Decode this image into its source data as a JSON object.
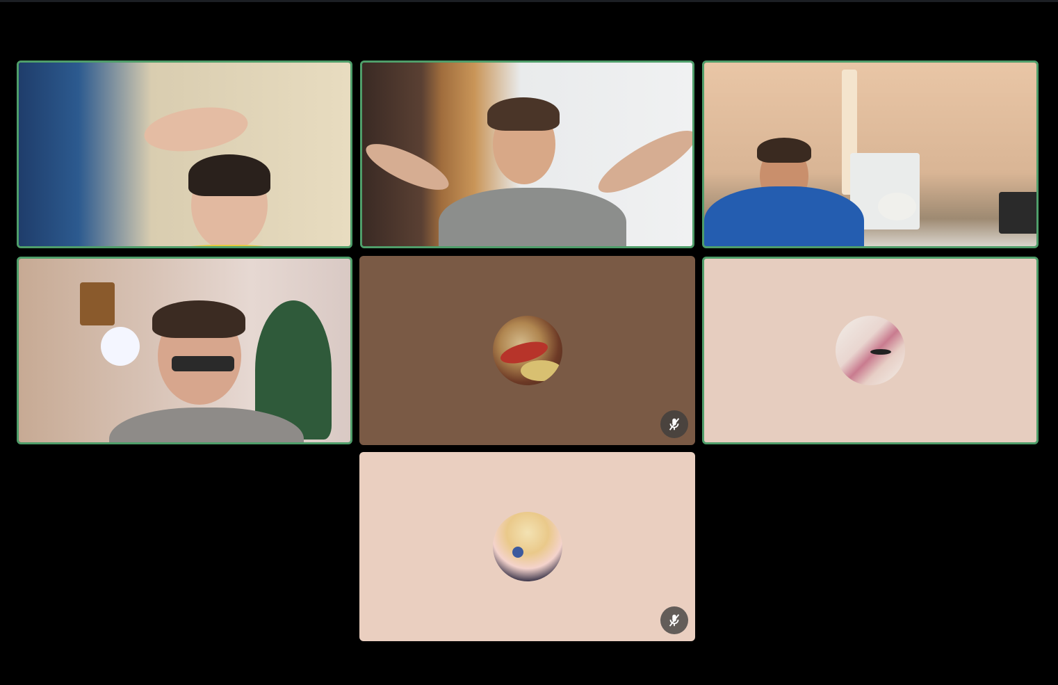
{
  "meeting": {
    "layout": "gallery",
    "accent_color": "#4f9e6a",
    "participants": [
      {
        "tile": "participant-1",
        "video": "on",
        "speaking": true,
        "background": "#8b7d6b"
      },
      {
        "tile": "participant-2",
        "video": "on",
        "speaking": true,
        "background": "#cfd3d4"
      },
      {
        "tile": "participant-3",
        "video": "on",
        "speaking": true,
        "background": "#d8b79d"
      },
      {
        "tile": "participant-4",
        "video": "on",
        "speaking": true,
        "background": "#c9b8b0"
      },
      {
        "tile": "participant-5",
        "video": "off",
        "speaking": false,
        "background": "#7a5a45",
        "avatar": "avatar-image",
        "muted": true,
        "mute_icon": "mic-muted-icon"
      },
      {
        "tile": "participant-6",
        "video": "off",
        "speaking": true,
        "background": "#e6cdbf",
        "avatar": "avatar-image",
        "muted": false
      },
      {
        "tile": "participant-7",
        "video": "off",
        "speaking": false,
        "background": "#eacfc0",
        "avatar": "avatar-image",
        "muted": true,
        "mute_icon": "mic-muted-icon"
      }
    ]
  }
}
